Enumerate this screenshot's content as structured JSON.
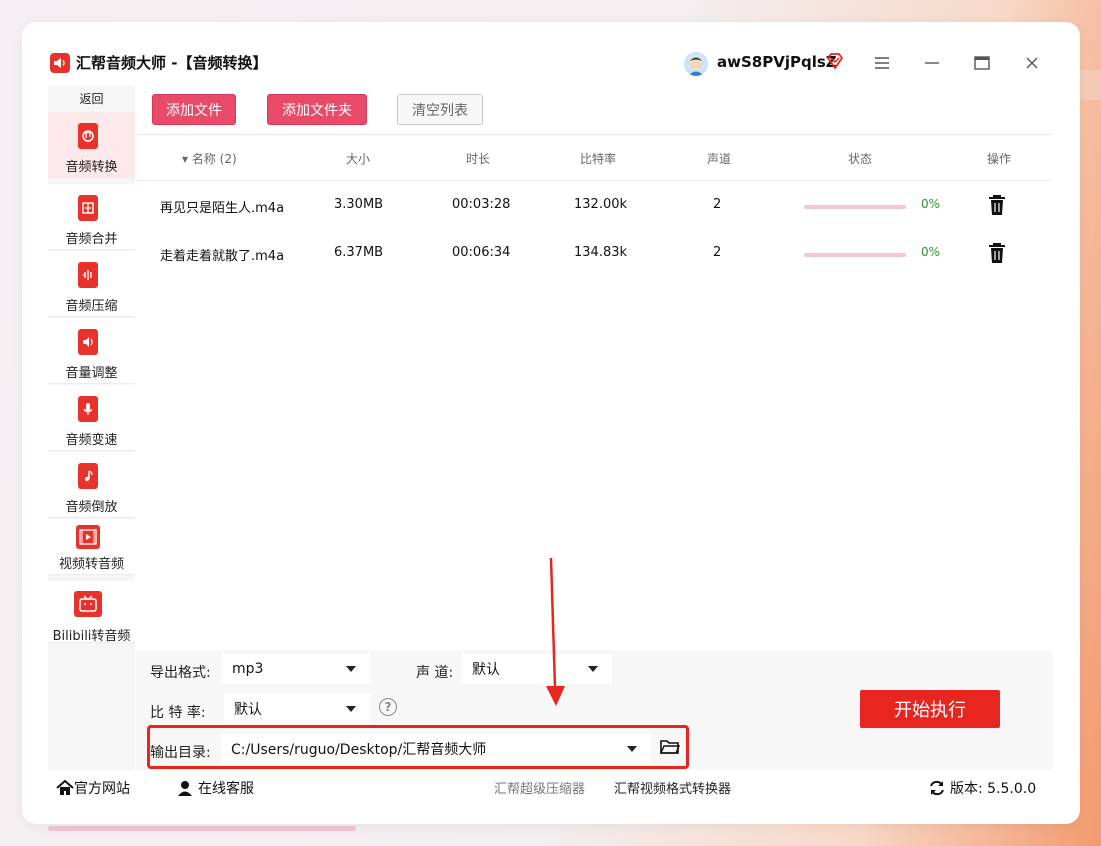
{
  "app": {
    "title": "汇帮音频大师  -【音频转换】",
    "username": "awS8PVjPqlsZ"
  },
  "sidebar": {
    "back_label": "返回",
    "items": [
      {
        "label": "音频转换",
        "icon": "audio-convert-icon",
        "active": true
      },
      {
        "label": "音频合并",
        "icon": "audio-merge-icon",
        "active": false
      },
      {
        "label": "音频压缩",
        "icon": "audio-compress-icon",
        "active": false
      },
      {
        "label": "音量调整",
        "icon": "volume-adjust-icon",
        "active": false
      },
      {
        "label": "音频变速",
        "icon": "audio-speed-icon",
        "active": false
      },
      {
        "label": "音频倒放",
        "icon": "audio-reverse-icon",
        "active": false
      },
      {
        "label": "视频转音频",
        "icon": "video-to-audio-icon",
        "active": false
      },
      {
        "label": "Bilibili转音频",
        "icon": "bilibili-icon",
        "active": false
      }
    ]
  },
  "toolbar": {
    "add_file": "添加文件",
    "add_folder": "添加文件夹",
    "clear_list": "清空列表"
  },
  "table": {
    "headers": {
      "name": "▾ 名称 (2)",
      "size": "大小",
      "duration": "时长",
      "bitrate": "比特率",
      "channels": "声道",
      "status": "状态",
      "action": "操作"
    },
    "rows": [
      {
        "name": "再见只是陌生人.m4a",
        "size": "3.30MB",
        "duration": "00:03:28",
        "bitrate": "132.00k",
        "channels": "2",
        "progress": 0,
        "progress_text": "0%"
      },
      {
        "name": "走着走着就散了.m4a",
        "size": "6.37MB",
        "duration": "00:06:34",
        "bitrate": "134.83k",
        "channels": "2",
        "progress": 0,
        "progress_text": "0%"
      }
    ]
  },
  "settings": {
    "format_label": "导出格式:",
    "format_value": "mp3",
    "channel_label": "声 道:",
    "channel_value": "默认",
    "bitrate_label": "比 特 率:",
    "bitrate_value": "默认",
    "help": "?",
    "output_label": "输出目录:",
    "output_value": "C:/Users/ruguo/Desktop/汇帮音频大师",
    "start_label": "开始执行"
  },
  "statusbar": {
    "website": "官方网站",
    "support": "在线客服",
    "link1": "汇帮超级压缩器",
    "link2": "汇帮视频格式转换器",
    "version": "版本: 5.5.0.0"
  },
  "colors": {
    "accent": "#e84a68",
    "brand_red": "#e8251e",
    "active_nav_bg": "#fde8ea",
    "success": "#2a9a2a"
  }
}
